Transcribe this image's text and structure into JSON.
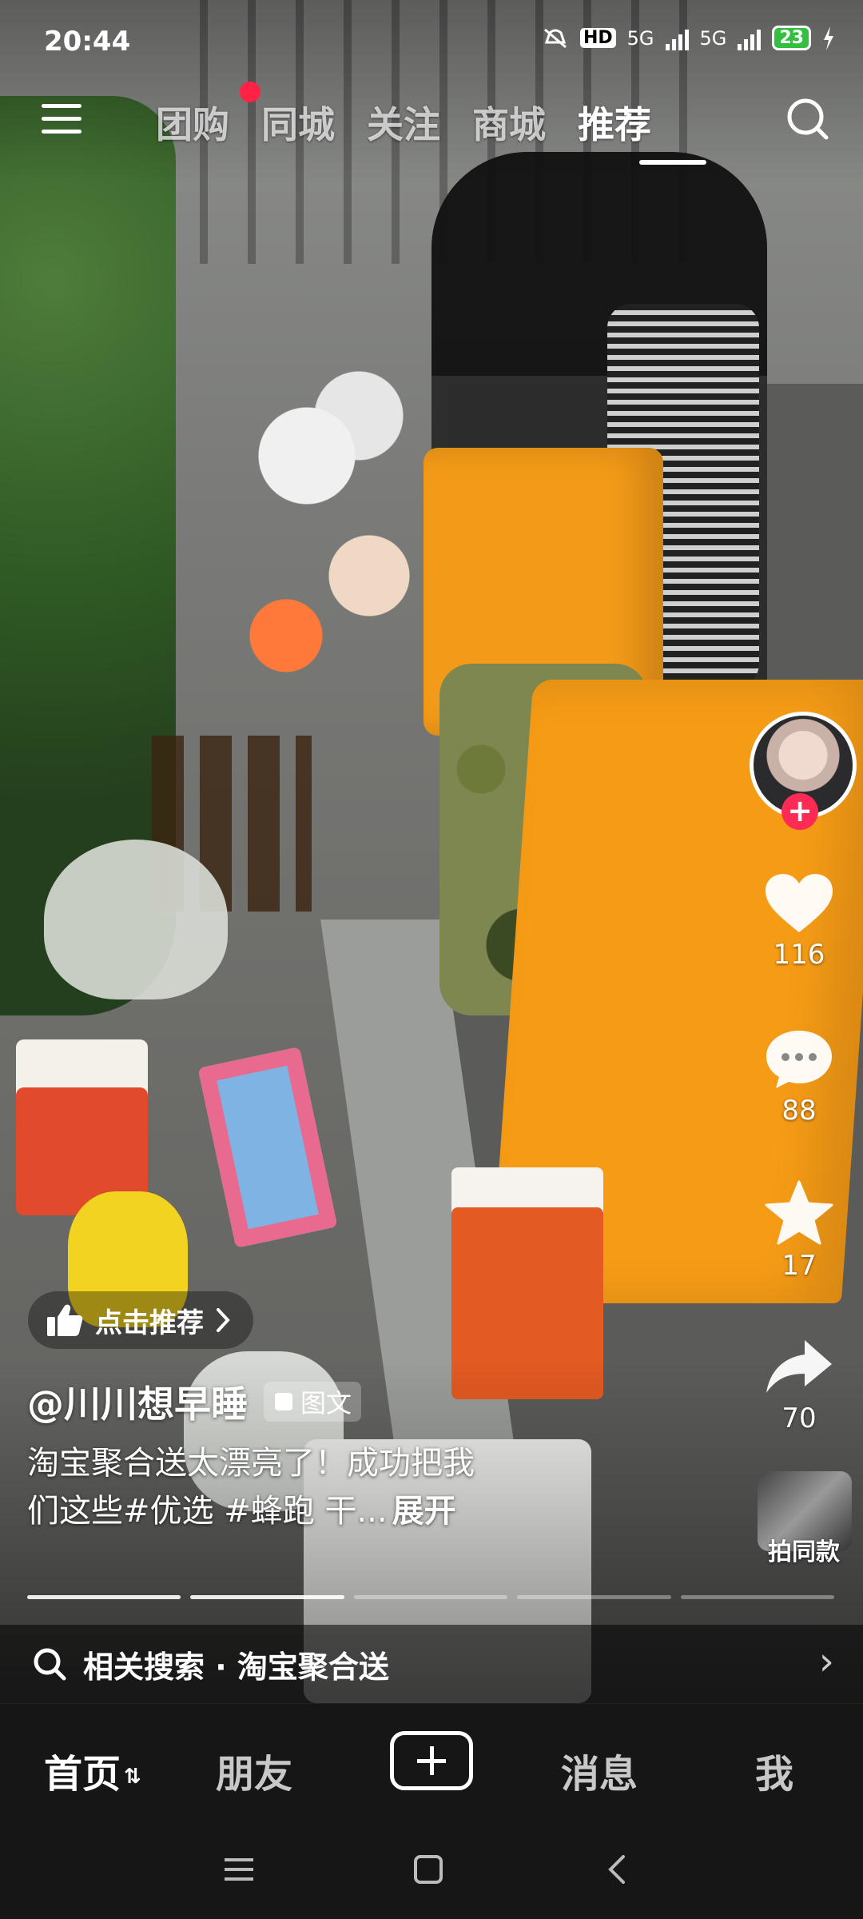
{
  "status_bar": {
    "time": "20:44",
    "hd": "HD",
    "network1": "5G",
    "network2": "5G",
    "battery": "23"
  },
  "top_nav": {
    "tabs": [
      "团购",
      "同城",
      "关注",
      "商城",
      "推荐"
    ],
    "active_tab": "推荐"
  },
  "right_rail": {
    "likes": "116",
    "comments": "88",
    "favorites": "17",
    "shares": "70",
    "music_label": "拍同款"
  },
  "post": {
    "recommend_pill": "点击推荐",
    "author": "@川川想早睡",
    "type_badge": "图文",
    "caption_line1": "淘宝聚合送太漂亮了！成功把我",
    "caption_line2": "们这些#优选 #蜂跑 干...",
    "expand": "展开",
    "progress_total": 5,
    "progress_current": 2
  },
  "related_search": {
    "label": "相关搜索 · 淘宝聚合送"
  },
  "bottom_nav": {
    "home": "首页",
    "friends": "朋友",
    "messages": "消息",
    "me": "我"
  },
  "colors": {
    "accent_red": "#fe2c55",
    "battery_green": "#33c040",
    "nav_bg": "#161616"
  }
}
